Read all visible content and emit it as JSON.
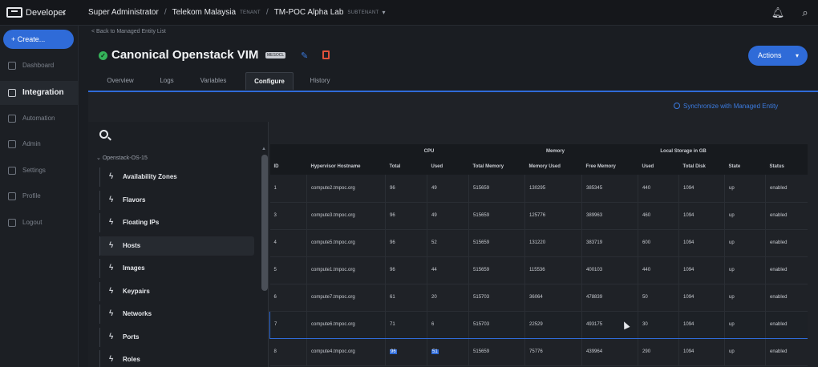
{
  "app": {
    "brand": "Developer"
  },
  "breadcrumb": {
    "user": "Super Administrator",
    "tenant": "Telekom Malaysia",
    "tenant_tag": "TENANT",
    "subtenant": "TM-POC Alpha Lab",
    "subtenant_tag": "SUBTENANT"
  },
  "sidebar": {
    "create_label": "+ Create...",
    "items": [
      {
        "label": "Dashboard"
      },
      {
        "label": "Integration"
      },
      {
        "label": "Automation"
      },
      {
        "label": "Admin"
      },
      {
        "label": "Settings"
      },
      {
        "label": "Profile"
      },
      {
        "label": "Logout"
      }
    ]
  },
  "header": {
    "back_link": "< Back to Managed Entity List",
    "title": "Canonical Openstack VIM",
    "badge": "MESOCL",
    "actions_label": "Actions"
  },
  "tabs": [
    {
      "label": "Overview"
    },
    {
      "label": "Logs"
    },
    {
      "label": "Variables"
    },
    {
      "label": "Configure"
    },
    {
      "label": "History"
    }
  ],
  "sync_label": "Synchronize with Managed Entity",
  "tree": {
    "root": "Openstack-OS-15",
    "items": [
      {
        "label": "Availability Zones"
      },
      {
        "label": "Flavors"
      },
      {
        "label": "Floating IPs"
      },
      {
        "label": "Hosts"
      },
      {
        "label": "Images"
      },
      {
        "label": "Keypairs"
      },
      {
        "label": "Networks"
      },
      {
        "label": "Ports"
      },
      {
        "label": "Roles"
      }
    ]
  },
  "table": {
    "groups": {
      "cpu": "CPU",
      "memory": "Memory",
      "storage": "Local Storage in GB"
    },
    "headers": [
      "ID",
      "Hypervisor Hostname",
      "Total",
      "Used",
      "Total Memory",
      "Memory Used",
      "Free Memory",
      "Used",
      "Total Disk",
      "State",
      "Status"
    ],
    "rows": [
      [
        "1",
        "compute2.tmpoc.org",
        "96",
        "49",
        "515659",
        "130295",
        "385345",
        "440",
        "1094",
        "up",
        "enabled"
      ],
      [
        "3",
        "compute3.tmpoc.org",
        "96",
        "49",
        "515659",
        "125776",
        "389963",
        "460",
        "1094",
        "up",
        "enabled"
      ],
      [
        "4",
        "compute5.tmpoc.org",
        "96",
        "52",
        "515659",
        "131220",
        "383719",
        "600",
        "1094",
        "up",
        "enabled"
      ],
      [
        "5",
        "compute1.tmpoc.org",
        "96",
        "44",
        "515659",
        "115536",
        "400103",
        "440",
        "1094",
        "up",
        "enabled"
      ],
      [
        "6",
        "compute7.tmpoc.org",
        "61",
        "20",
        "515703",
        "36064",
        "478839",
        "50",
        "1094",
        "up",
        "enabled"
      ],
      [
        "7",
        "compute6.tmpoc.org",
        "71",
        "6",
        "515703",
        "22529",
        "493175",
        "30",
        "1094",
        "up",
        "enabled"
      ],
      [
        "8",
        "compute4.tmpoc.org",
        "96",
        "51",
        "515659",
        "75776",
        "439964",
        "290",
        "1094",
        "up",
        "enabled"
      ]
    ]
  }
}
